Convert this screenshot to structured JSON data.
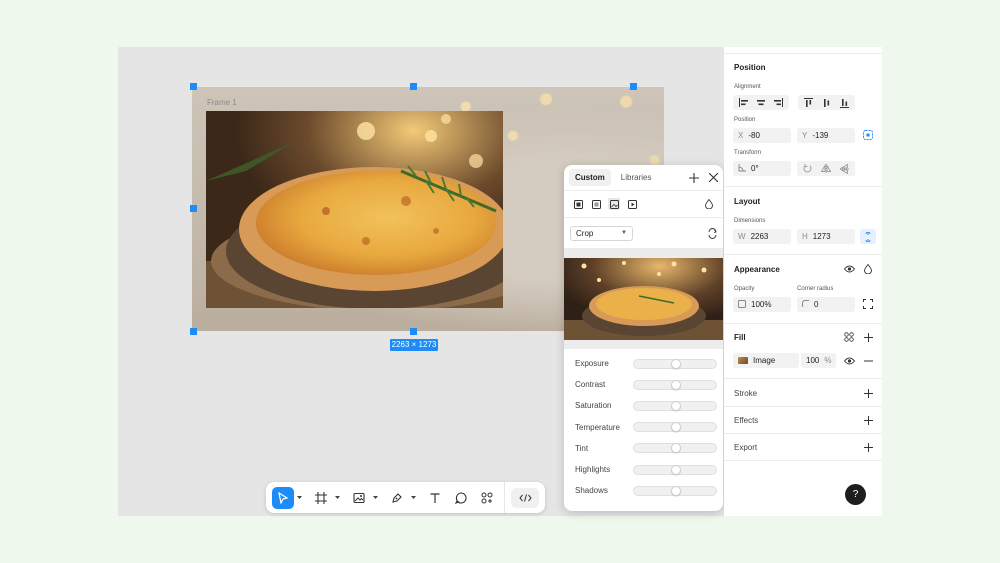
{
  "canvas": {
    "frame_label": "Frame 1",
    "size_badge": "2263 × 1273"
  },
  "toolbar": {
    "tools": [
      "select-tool",
      "frame-tool",
      "image-tool",
      "pen-tool",
      "text-tool",
      "comment-tool",
      "components-tool",
      "code-tool"
    ],
    "active_tool": "select-tool"
  },
  "popover": {
    "tabs": [
      "Custom",
      "Libraries"
    ],
    "active_tab": "Custom",
    "fill_mode": "Crop",
    "adjustments": [
      {
        "label": "Exposure",
        "value": 0.5
      },
      {
        "label": "Contrast",
        "value": 0.5
      },
      {
        "label": "Saturation",
        "value": 0.5
      },
      {
        "label": "Temperature",
        "value": 0.5
      },
      {
        "label": "Tint",
        "value": 0.5
      },
      {
        "label": "Highlights",
        "value": 0.5
      },
      {
        "label": "Shadows",
        "value": 0.5
      }
    ]
  },
  "panel": {
    "position": {
      "title": "Position",
      "alignment_label": "Alignment",
      "position_label": "Position",
      "x_prefix": "X",
      "x_value": "-80",
      "y_prefix": "Y",
      "y_value": "-139",
      "transform_label": "Transform",
      "rotation_value": "0°"
    },
    "layout": {
      "title": "Layout",
      "dimensions_label": "Dimensions",
      "w_prefix": "W",
      "w_value": "2263",
      "h_prefix": "H",
      "h_value": "1273"
    },
    "appearance": {
      "title": "Appearance",
      "opacity_label": "Opacity",
      "opacity_value": "100%",
      "radius_label": "Corner radius",
      "radius_value": "0"
    },
    "fill": {
      "title": "Fill",
      "type": "Image",
      "opacity_value": "100",
      "percent": "%"
    },
    "stroke_title": "Stroke",
    "effects_title": "Effects",
    "export_title": "Export"
  },
  "help": "?",
  "colors": {
    "accent": "#1d8cf8",
    "background": "#eff8ec",
    "canvas": "#e5e5e5"
  }
}
